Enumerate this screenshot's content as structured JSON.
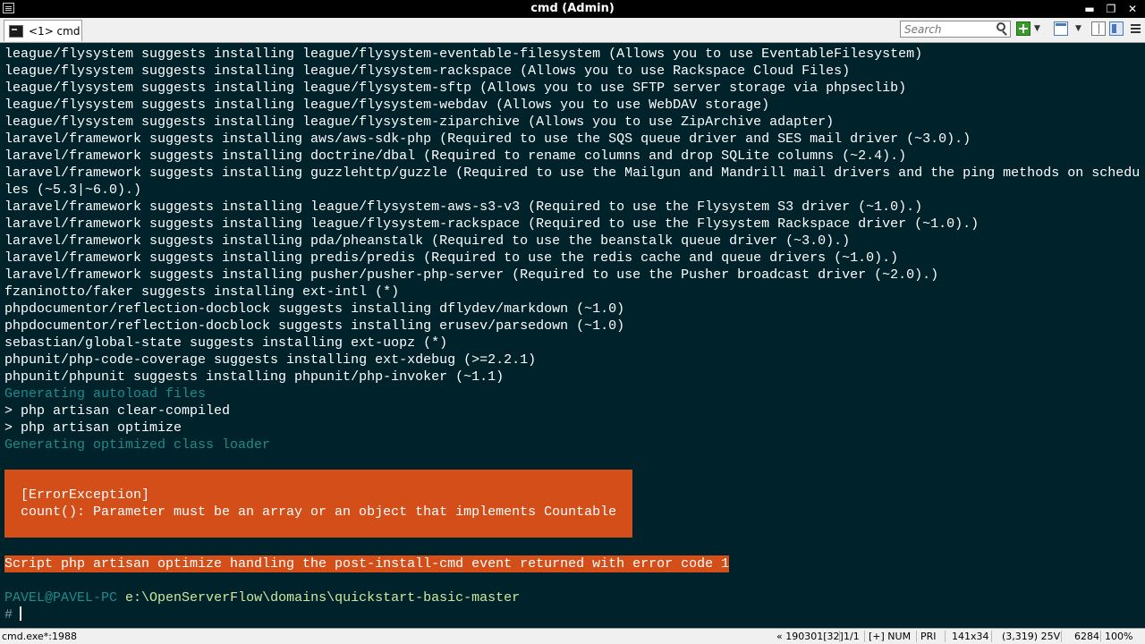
{
  "window": {
    "title": "cmd (Admin)",
    "buttons": {
      "minimize": "▬",
      "restore": "❐",
      "close": "✕"
    }
  },
  "toolbar": {
    "tab_label": "<1> cmd",
    "search_placeholder": "Search",
    "icons": [
      "search-icon",
      "plus-icon",
      "window-icon",
      "split-icon",
      "panel-icon",
      "menu-icon"
    ]
  },
  "console": {
    "lines": [
      {
        "text": "league/flysystem suggests installing league/flysystem-eventable-filesystem (Allows you to use EventableFilesystem)",
        "style": "normal"
      },
      {
        "text": "league/flysystem suggests installing league/flysystem-rackspace (Allows you to use Rackspace Cloud Files)",
        "style": "normal"
      },
      {
        "text": "league/flysystem suggests installing league/flysystem-sftp (Allows you to use SFTP server storage via phpseclib)",
        "style": "normal"
      },
      {
        "text": "league/flysystem suggests installing league/flysystem-webdav (Allows you to use WebDAV storage)",
        "style": "normal"
      },
      {
        "text": "league/flysystem suggests installing league/flysystem-ziparchive (Allows you to use ZipArchive adapter)",
        "style": "normal"
      },
      {
        "text": "laravel/framework suggests installing aws/aws-sdk-php (Required to use the SQS queue driver and SES mail driver (~3.0).)",
        "style": "normal"
      },
      {
        "text": "laravel/framework suggests installing doctrine/dbal (Required to rename columns and drop SQLite columns (~2.4).)",
        "style": "normal"
      },
      {
        "text": "laravel/framework suggests installing guzzlehttp/guzzle (Required to use the Mailgun and Mandrill mail drivers and the ping methods on schedu",
        "style": "normal"
      },
      {
        "text": "les (~5.3|~6.0).)",
        "style": "normal"
      },
      {
        "text": "laravel/framework suggests installing league/flysystem-aws-s3-v3 (Required to use the Flysystem S3 driver (~1.0).)",
        "style": "normal"
      },
      {
        "text": "laravel/framework suggests installing league/flysystem-rackspace (Required to use the Flysystem Rackspace driver (~1.0).)",
        "style": "normal"
      },
      {
        "text": "laravel/framework suggests installing pda/pheanstalk (Required to use the beanstalk queue driver (~3.0).)",
        "style": "normal"
      },
      {
        "text": "laravel/framework suggests installing predis/predis (Required to use the redis cache and queue drivers (~1.0).)",
        "style": "normal"
      },
      {
        "text": "laravel/framework suggests installing pusher/pusher-php-server (Required to use the Pusher broadcast driver (~2.0).)",
        "style": "normal"
      },
      {
        "text": "fzaninotto/faker suggests installing ext-intl (*)",
        "style": "normal"
      },
      {
        "text": "phpdocumentor/reflection-docblock suggests installing dflydev/markdown (~1.0)",
        "style": "normal"
      },
      {
        "text": "phpdocumentor/reflection-docblock suggests installing erusev/parsedown (~1.0)",
        "style": "normal"
      },
      {
        "text": "sebastian/global-state suggests installing ext-uopz (*)",
        "style": "normal"
      },
      {
        "text": "phpunit/php-code-coverage suggests installing ext-xdebug (>=2.2.1)",
        "style": "normal"
      },
      {
        "text": "phpunit/phpunit suggests installing phpunit/php-invoker (~1.1)",
        "style": "normal"
      },
      {
        "text": "Generating autoload files",
        "style": "dim"
      },
      {
        "text": "> php artisan clear-compiled",
        "style": "normal"
      },
      {
        "text": "> php artisan optimize",
        "style": "normal"
      },
      {
        "text": "Generating optimized class loader",
        "style": "dim"
      }
    ],
    "error": {
      "title": "[ErrorException]",
      "message": "count(): Parameter must be an array or an object that implements Countable"
    },
    "script_error": "Script php artisan optimize handling the post-install-cmd event returned with error code 1",
    "prompt": {
      "user": "PAVEL@PAVEL-PC",
      "path": "e:\\OpenServerFlow\\domains\\quickstart-basic-master",
      "symbol": "#"
    }
  },
  "statusbar": {
    "process": "cmd.exe*:1988",
    "build": "« 190301[32]",
    "console_index": "1/1",
    "flags": "[+] NUM",
    "priority": "PRI",
    "size": "141x34",
    "cursor_pos": "(3,319) 25V",
    "pid": "6284",
    "transparency": "100%"
  }
}
